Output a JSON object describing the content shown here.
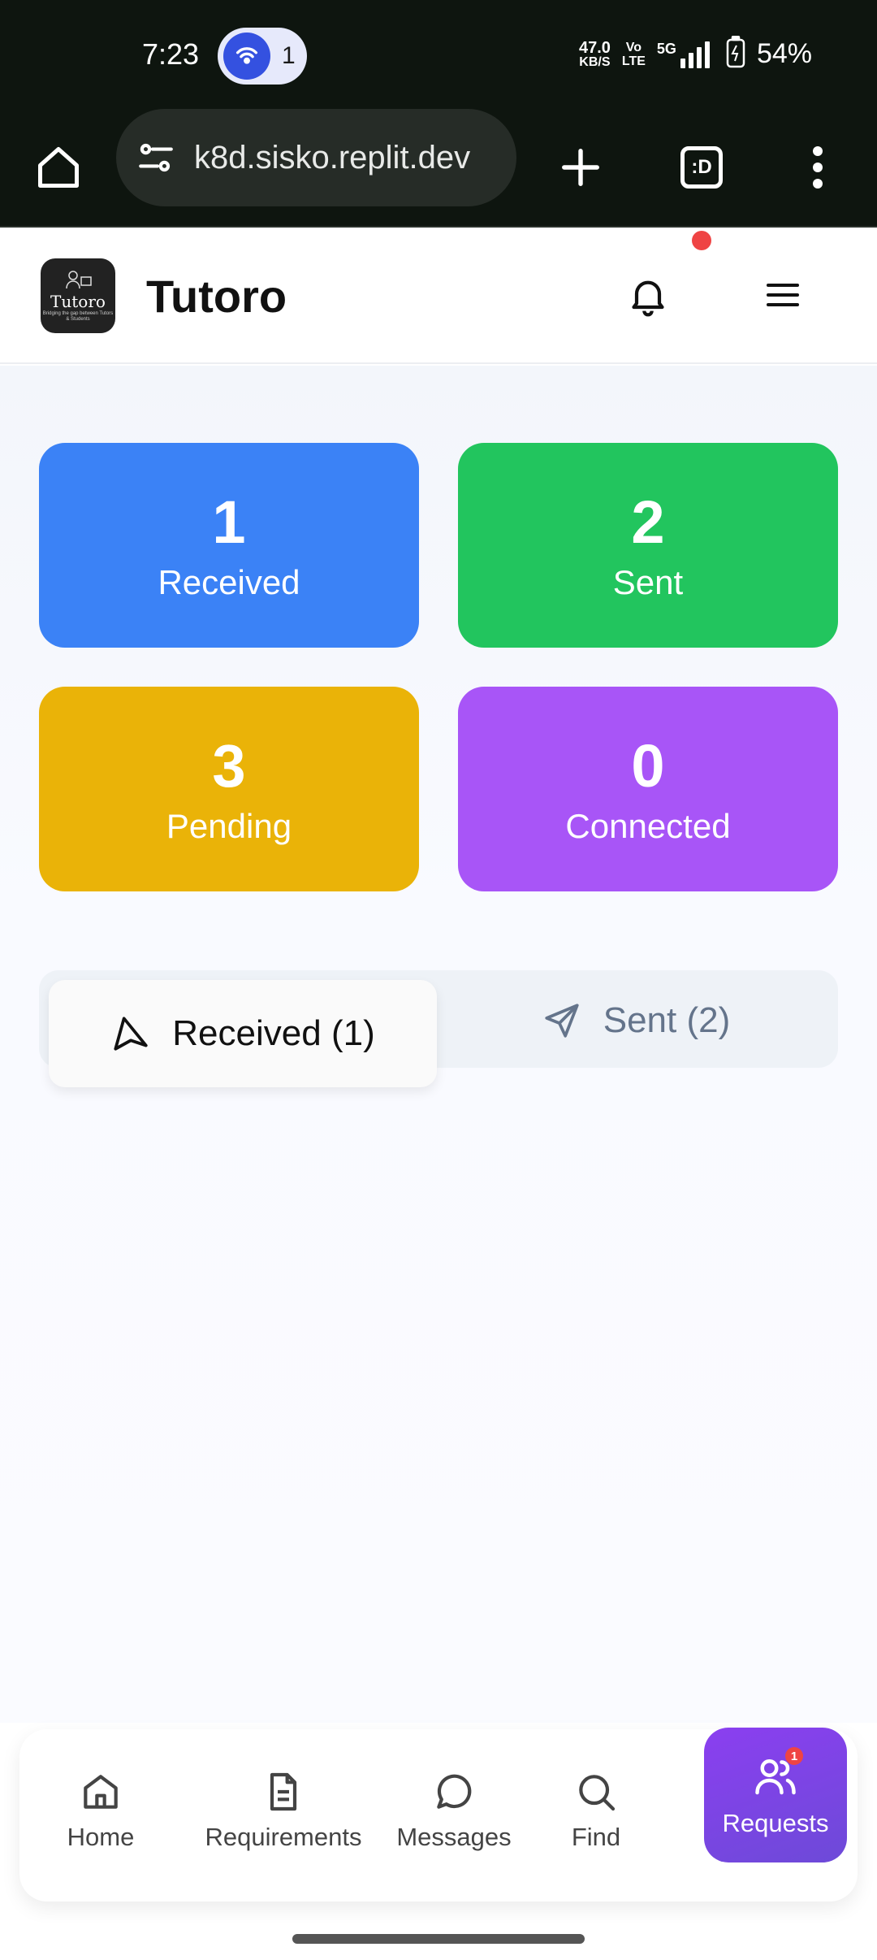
{
  "status_bar": {
    "time": "7:23",
    "hotspot_count": "1",
    "speed_value": "47.0",
    "speed_unit": "KB/S",
    "volte_top": "Vo",
    "volte_bottom": "LTE",
    "network": "5G",
    "battery_percent": "54%"
  },
  "browser": {
    "url": "k8d.sisko.replit.dev",
    "tab_label": ":D"
  },
  "header": {
    "app_title": "Tutoro",
    "logo_text": "Tutoro",
    "logo_tagline": "Bridging the gap between Tutors & Students",
    "has_notification": true
  },
  "stats": [
    {
      "value": "1",
      "label": "Received",
      "color": "#3b82f6"
    },
    {
      "value": "2",
      "label": "Sent",
      "color": "#22c55e"
    },
    {
      "value": "3",
      "label": "Pending",
      "color": "#eab308"
    },
    {
      "value": "0",
      "label": "Connected",
      "color": "#a855f7"
    }
  ],
  "tabs": [
    {
      "label": "Received (1)",
      "active": true
    },
    {
      "label": "Sent (2)",
      "active": false
    }
  ],
  "bottom_nav": [
    {
      "label": "Home",
      "icon": "home-icon"
    },
    {
      "label": "Requirements",
      "icon": "document-icon"
    },
    {
      "label": "Messages",
      "icon": "message-icon"
    },
    {
      "label": "Find",
      "icon": "search-icon"
    },
    {
      "label": "Requests",
      "icon": "users-icon",
      "active": true,
      "badge": "1"
    }
  ],
  "colors": {
    "accent": "#7c3aed",
    "notification": "#ef4444"
  }
}
